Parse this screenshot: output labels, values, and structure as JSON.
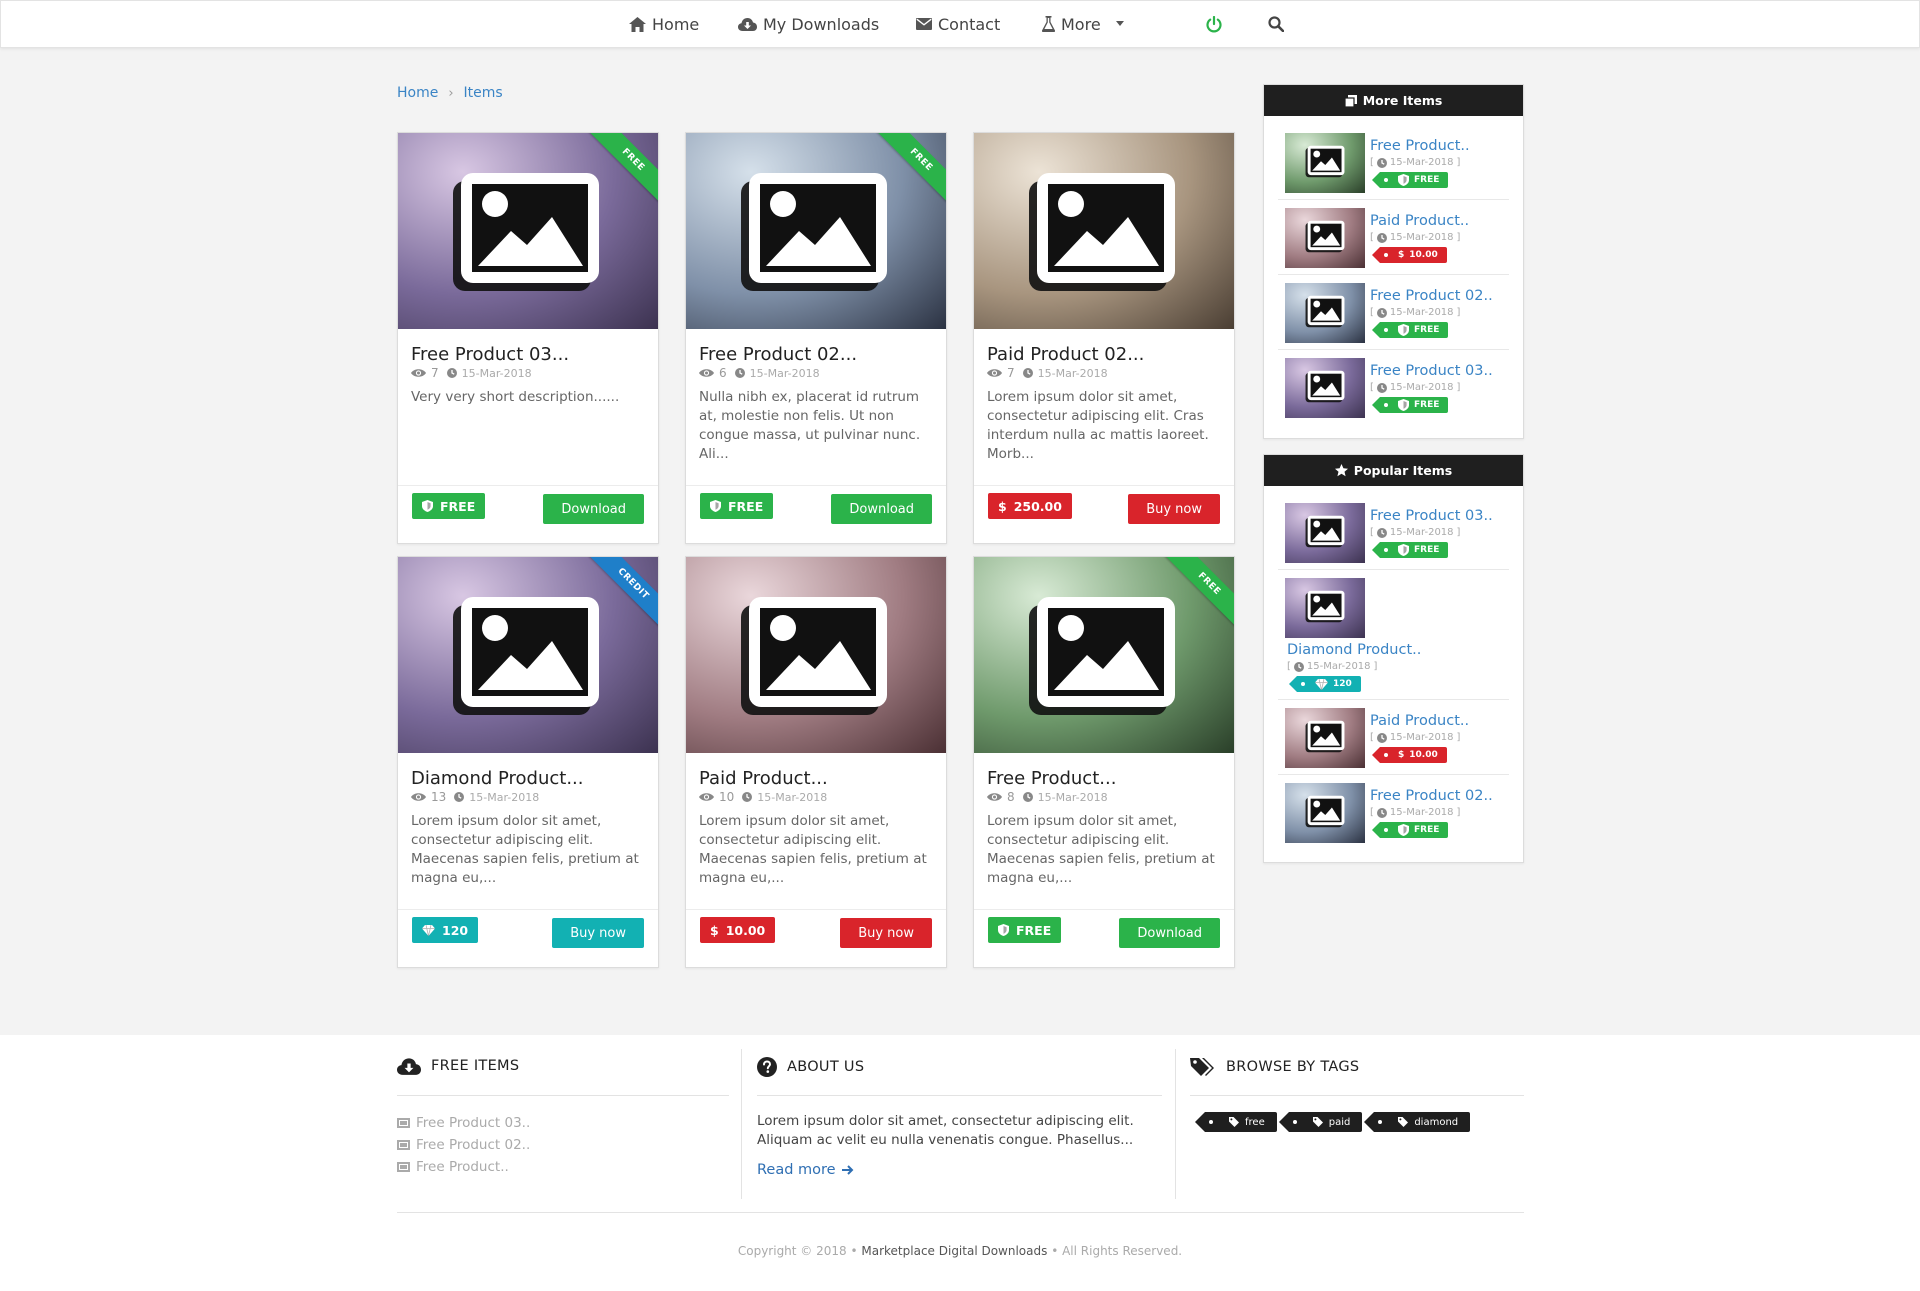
{
  "nav": {
    "home": "Home",
    "downloads": "My Downloads",
    "contact": "Contact",
    "more": "More"
  },
  "breadcrumb": [
    "Home",
    "Items"
  ],
  "colors": {
    "green": "#2bb34a",
    "red": "#d9242b",
    "teal": "#12b1b3",
    "blue": "#1f7fc9",
    "link": "#3a84c5",
    "dark": "#1f1f1f"
  },
  "products": [
    {
      "title": "Free Product 03...",
      "views": "7",
      "date": "15-Mar-2018",
      "description": "Very very short description......",
      "price": "FREE",
      "price_type": "free",
      "button": "Download",
      "ribbon": "FREE",
      "ribbon_color": "green",
      "thumb_colors": [
        "#d8c7e3",
        "#7a6a9a",
        "#3c3250"
      ]
    },
    {
      "title": "Free Product 02...",
      "views": "6",
      "date": "15-Mar-2018",
      "description": "Nulla nibh ex, placerat id rutrum at, molestie non felis. Ut non congue massa, ut pulvinar nunc. Ali...",
      "price": "FREE",
      "price_type": "free",
      "button": "Download",
      "ribbon": "FREE",
      "ribbon_color": "green",
      "thumb_colors": [
        "#d5e0ea",
        "#7f90a8",
        "#2b3242"
      ]
    },
    {
      "title": "Paid Product 02...",
      "views": "7",
      "date": "15-Mar-2018",
      "description": "Lorem ipsum dolor sit amet, consectetur adipiscing elit. Cras interdum nulla ac mattis laoreet. Morb...",
      "price": "250.00",
      "price_type": "paid",
      "button": "Buy now",
      "ribbon": "",
      "ribbon_color": "",
      "thumb_colors": [
        "#ece3d6",
        "#a8957f",
        "#4a3e33"
      ]
    },
    {
      "title": "Diamond Product...",
      "views": "13",
      "date": "15-Mar-2018",
      "description": "Lorem ipsum dolor sit amet, consectetur adipiscing elit. Maecenas sapien felis, pretium at magna eu,...",
      "price": "120",
      "price_type": "credit",
      "button": "Buy now",
      "ribbon": "CREDIT",
      "ribbon_color": "blue",
      "thumb_colors": [
        "#d8c7e3",
        "#7a6a9a",
        "#3c3250"
      ]
    },
    {
      "title": "Paid Product...",
      "views": "10",
      "date": "15-Mar-2018",
      "description": "Lorem ipsum dolor sit amet, consectetur adipiscing elit. Maecenas sapien felis, pretium at magna eu,...",
      "price": "10.00",
      "price_type": "paid",
      "button": "Buy now",
      "ribbon": "",
      "ribbon_color": "",
      "thumb_colors": [
        "#ead7db",
        "#a07c82",
        "#4b3034"
      ]
    },
    {
      "title": "Free Product...",
      "views": "8",
      "date": "15-Mar-2018",
      "description": "Lorem ipsum dolor sit amet, consectetur adipiscing elit. Maecenas sapien felis, pretium at magna eu,...",
      "price": "FREE",
      "price_type": "free",
      "button": "Download",
      "ribbon": "FREE",
      "ribbon_color": "green",
      "thumb_colors": [
        "#d8ead5",
        "#6f9a6c",
        "#2a3f29"
      ]
    }
  ],
  "more_items": {
    "title": "More Items",
    "items": [
      {
        "title": "Free Product..",
        "date": "15-Mar-2018",
        "price": "FREE",
        "price_type": "free",
        "thumb_colors": [
          "#d8ead5",
          "#6f9a6c",
          "#2a3f29"
        ]
      },
      {
        "title": "Paid Product..",
        "date": "15-Mar-2018",
        "price": "10.00",
        "price_type": "paid",
        "thumb_colors": [
          "#ead7db",
          "#a07c82",
          "#4b3034"
        ]
      },
      {
        "title": "Free Product 02..",
        "date": "15-Mar-2018",
        "price": "FREE",
        "price_type": "free",
        "thumb_colors": [
          "#d5e0ea",
          "#7f90a8",
          "#2b3242"
        ]
      },
      {
        "title": "Free Product 03..",
        "date": "15-Mar-2018",
        "price": "FREE",
        "price_type": "free",
        "thumb_colors": [
          "#d8c7e3",
          "#7a6a9a",
          "#3c3250"
        ]
      }
    ]
  },
  "popular_items": {
    "title": "Popular Items",
    "items": [
      {
        "title": "Free Product 03..",
        "date": "15-Mar-2018",
        "price": "FREE",
        "price_type": "free",
        "layout": "side",
        "thumb_colors": [
          "#d8c7e3",
          "#7a6a9a",
          "#3c3250"
        ]
      },
      {
        "title": "Diamond Product..",
        "date": "15-Mar-2018",
        "price": "120",
        "price_type": "credit",
        "layout": "stack",
        "thumb_colors": [
          "#d8c7e3",
          "#7a6a9a",
          "#3c3250"
        ]
      },
      {
        "title": "Paid Product..",
        "date": "15-Mar-2018",
        "price": "10.00",
        "price_type": "paid",
        "layout": "side",
        "thumb_colors": [
          "#ead7db",
          "#a07c82",
          "#4b3034"
        ]
      },
      {
        "title": "Free Product 02..",
        "date": "15-Mar-2018",
        "price": "FREE",
        "price_type": "free",
        "layout": "side",
        "thumb_colors": [
          "#d5e0ea",
          "#7f90a8",
          "#2b3242"
        ]
      }
    ]
  },
  "footer": {
    "free_items": {
      "heading": "FREE ITEMS",
      "items": [
        "Free Product 03..",
        "Free Product 02..",
        "Free Product.."
      ]
    },
    "about": {
      "heading": "ABOUT US",
      "text": "Lorem ipsum dolor sit amet, consectetur adipiscing elit. Aliquam ac velit eu nulla venenatis congue. Phasellus...",
      "read_more": "Read more"
    },
    "tags": {
      "heading": "BROWSE BY TAGS",
      "items": [
        "free",
        "paid",
        "diamond"
      ]
    },
    "copyright_prefix": "Copyright © 2018 •",
    "brand": "Marketplace Digital Downloads",
    "copyright_suffix": "• All Rights Reserved."
  }
}
